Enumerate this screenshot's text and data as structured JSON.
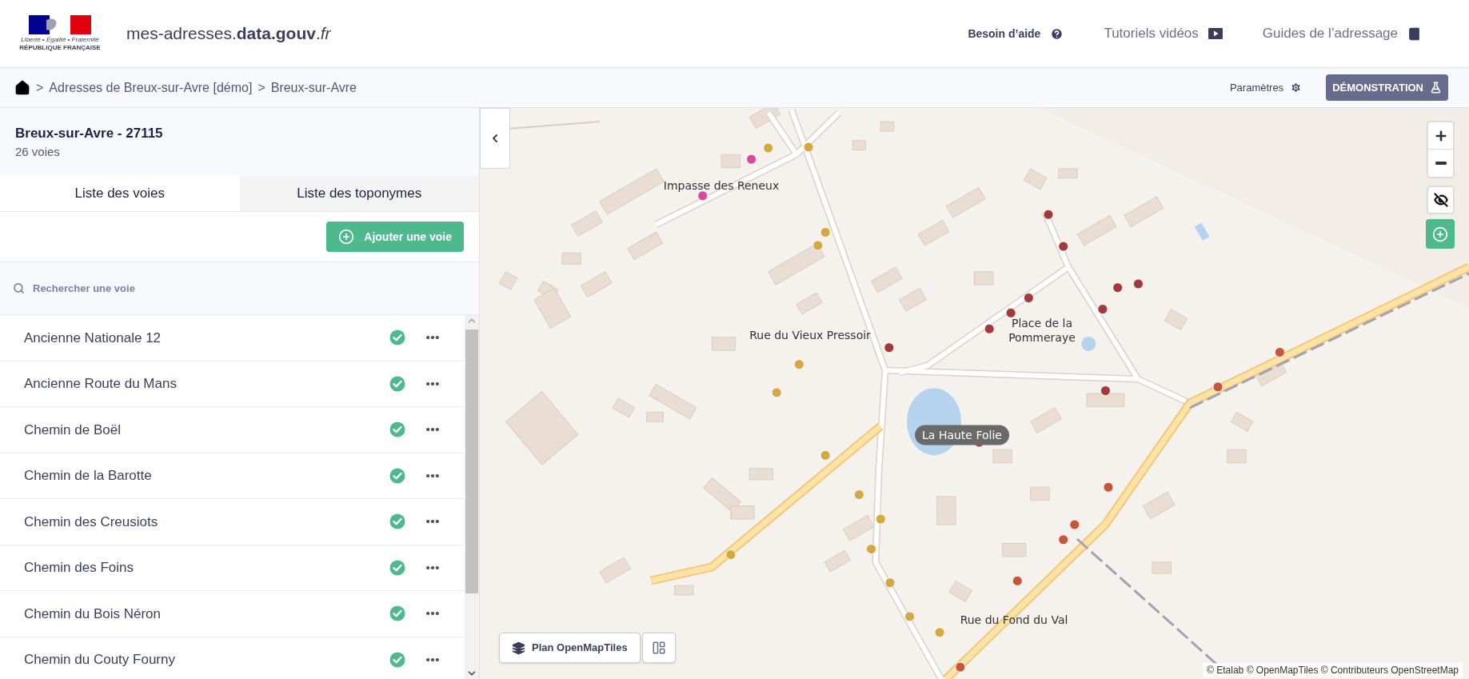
{
  "header": {
    "logo": {
      "motto": "Liberté • Égalité • Fraternité",
      "name": "RÉPUBLIQUE FRANÇAISE"
    },
    "site_name": "mes-adresses.**data.gouv**.*fr*",
    "nav": [
      {
        "label": "Besoin d’aide",
        "kind": "help"
      },
      {
        "label": "Tutoriels vidéos",
        "kind": "video"
      },
      {
        "label": "Guides de l’adressage",
        "kind": "guide"
      }
    ]
  },
  "breadcrumb": [
    {
      "kind": "home"
    },
    {
      "kind": "separator",
      "text": ">"
    },
    {
      "kind": "link",
      "text": "Adresses de Breux-sur-Avre [démo]"
    },
    {
      "kind": "separator",
      "text": ">"
    },
    {
      "kind": "current",
      "text": "Breux-sur-Avre"
    }
  ],
  "toolbar": {
    "settings": "Paramètres",
    "badge": "DÉMONSTRATION"
  },
  "commune": {
    "title": "Breux-sur-Avre - 27115",
    "subtitle": "26 voies"
  },
  "tabs": [
    {
      "label": "Liste des voies",
      "selected": true
    },
    {
      "label": "Liste des toponymes",
      "selected": false
    }
  ],
  "add_button": "Ajouter une voie",
  "search": {
    "placeholder": "Rechercher une voie"
  },
  "voies": [
    {
      "name": "Ancienne Nationale 12",
      "validated": true
    },
    {
      "name": "Ancienne Route du Mans",
      "validated": true
    },
    {
      "name": "Chemin de Boël",
      "validated": true
    },
    {
      "name": "Chemin de la Barotte",
      "validated": true
    },
    {
      "name": "Chemin des Creusiots",
      "validated": true
    },
    {
      "name": "Chemin des Foins",
      "validated": true
    },
    {
      "name": "Chemin du Bois Néron",
      "validated": true
    },
    {
      "name": "Chemin du Couty Fourny",
      "validated": true
    }
  ],
  "map": {
    "labels": [
      {
        "text": "Impasse des Reneux",
        "kind": "street"
      },
      {
        "text": "Rue du Vieux Pressoir",
        "kind": "street"
      },
      {
        "text": "Place de la Pommeraye",
        "kind": "street"
      },
      {
        "text": "La Haute Folie",
        "kind": "toponym"
      },
      {
        "text": "Rue du Fond du Val",
        "kind": "street"
      }
    ],
    "style_button": "Plan OpenMapTiles",
    "attribution": "© Etalab © OpenMapTiles © Contributeurs OpenStreetMap"
  }
}
